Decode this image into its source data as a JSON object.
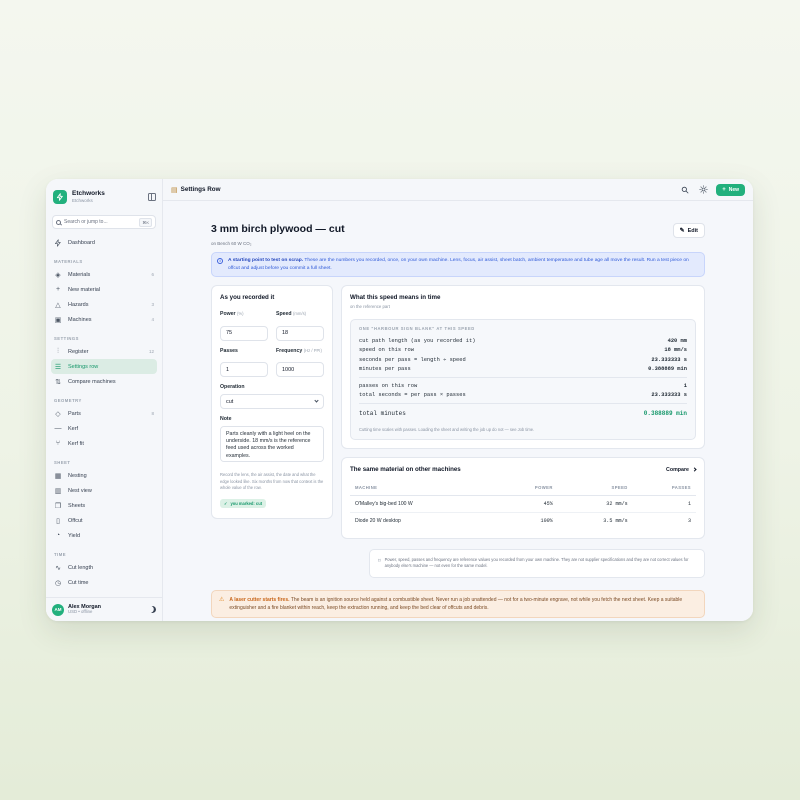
{
  "brand": {
    "name": "Etchworks",
    "sub": "Etchworks"
  },
  "search": {
    "placeholder": "Search or jump to...",
    "shortcut": "⌘K"
  },
  "sidebar": {
    "dashboard": "Dashboard",
    "sections": [
      {
        "title": "MATERIALS",
        "items": [
          {
            "label": "Materials",
            "count": "6",
            "icon": "layers-icon"
          },
          {
            "label": "New material",
            "count": "",
            "icon": "plus-icon"
          },
          {
            "label": "Hazards",
            "count": "3",
            "icon": "warning-icon"
          },
          {
            "label": "Machines",
            "count": "4",
            "icon": "machine-icon"
          }
        ]
      },
      {
        "title": "SETTINGS",
        "items": [
          {
            "label": "Register",
            "count": "12",
            "icon": "sliders-icon"
          },
          {
            "label": "Settings row",
            "count": "",
            "icon": "list-icon",
            "active": true
          },
          {
            "label": "Compare machines",
            "count": "",
            "icon": "compare-icon"
          }
        ]
      },
      {
        "title": "GEOMETRY",
        "items": [
          {
            "label": "Parts",
            "count": "8",
            "icon": "tag-icon"
          },
          {
            "label": "Kerf",
            "count": "",
            "icon": "minus-icon"
          },
          {
            "label": "Kerf fit",
            "count": "",
            "icon": "fork-icon"
          }
        ]
      },
      {
        "title": "SHEET",
        "items": [
          {
            "label": "Nesting",
            "count": "",
            "icon": "grid-icon"
          },
          {
            "label": "Nest view",
            "count": "",
            "icon": "panel-icon"
          },
          {
            "label": "Sheets",
            "count": "",
            "icon": "sheets-icon"
          },
          {
            "label": "Offcut",
            "count": "",
            "icon": "trash-icon"
          },
          {
            "label": "Yield",
            "count": "",
            "icon": "pie-icon"
          }
        ]
      },
      {
        "title": "TIME",
        "items": [
          {
            "label": "Cut length",
            "count": "",
            "icon": "pulse-icon"
          },
          {
            "label": "Cut time",
            "count": "",
            "icon": "clock-icon"
          }
        ]
      }
    ]
  },
  "user": {
    "initials": "AM",
    "name": "Alex Morgan",
    "sub": "USD • offline"
  },
  "topbar": {
    "title": "Settings Row",
    "new_label": "New"
  },
  "page": {
    "title": "3 mm birch plywood — cut",
    "subtitle": "on Bench 60 W CO₂",
    "edit_label": "Edit"
  },
  "banner": {
    "strong": "A starting point to test on scrap.",
    "text": " These are the numbers you recorded, once, on your own machine. Lens, focus, air assist, sheet batch, ambient temperature and tube age all move the result. Run a test piece on offcut and adjust before you commit a full sheet."
  },
  "recorded": {
    "title": "As you recorded it",
    "power_label": "Power",
    "power_unit": "(%)",
    "power_value": "75",
    "speed_label": "Speed",
    "speed_unit": "(mm/s)",
    "speed_value": "18",
    "passes_label": "Passes",
    "passes_value": "1",
    "freq_label": "Frequency",
    "freq_unit": "(Hz / PPI)",
    "freq_value": "1000",
    "operation_label": "Operation",
    "operation_value": "cut",
    "note_label": "Note",
    "note_value": "Parts cleanly with a light heel on the underside. 18 mm/s is the reference feed used across the worked examples.",
    "hint": "Record the lens, the air assist, the date and what the edge looked like. Six months from now that context is the whole value of the row.",
    "badge": "you marked: cut"
  },
  "time_card": {
    "title": "What this speed means in time",
    "subtitle": "on the reference part",
    "calc_title": "ONE \"HARBOUR SIGN BLANK\" AT THIS SPEED",
    "rows": [
      {
        "label": "cut path length (as you recorded it)",
        "value": "420 mm"
      },
      {
        "label": "speed on this row",
        "value": "18 mm/s"
      },
      {
        "label": "seconds per pass = length ÷ speed",
        "value": "23.333333 s"
      },
      {
        "label": "minutes per pass",
        "value": "0.388889 min"
      }
    ],
    "rows2": [
      {
        "label": "passes on this row",
        "value": "1"
      },
      {
        "label": "total seconds = per pass × passes",
        "value": "23.333333 s"
      }
    ],
    "total_label": "total minutes",
    "total_value": "0.388889 min",
    "note": "Cutting time scales with passes. Loading the sheet and writing the job up do not — see Job time."
  },
  "machines_card": {
    "title": "The same material on other machines",
    "compare_label": "Compare",
    "headers": [
      "MACHINE",
      "POWER",
      "SPEED",
      "PASSES"
    ],
    "rows": [
      {
        "machine": "O'Malley's big-bed 100 W",
        "power": "45%",
        "speed": "32 mm/s",
        "passes": "1"
      },
      {
        "machine": "Diode 20 W desktop",
        "power": "100%",
        "speed": "3.5 mm/s",
        "passes": "3"
      }
    ]
  },
  "disclaimer": "Power, speed, passes and frequency are reference values you recorded from your own machine. They are not supplier specifications and they are not correct values for anybody else's machine — not even for the same model.",
  "warning": {
    "strong": "A laser cutter starts fires.",
    "text": " The beam is an ignition source held against a combustible sheet. Never run a job unattended — not for a two-minute engrave, not while you fetch the next sheet. Keep a suitable extinguisher and a fire blanket within reach, keep the extraction running, and keep the bed clear of offcuts and debris."
  },
  "colors": {
    "accent": "#22b07d",
    "info": "#2f5ad8",
    "warning": "#e08a28"
  }
}
